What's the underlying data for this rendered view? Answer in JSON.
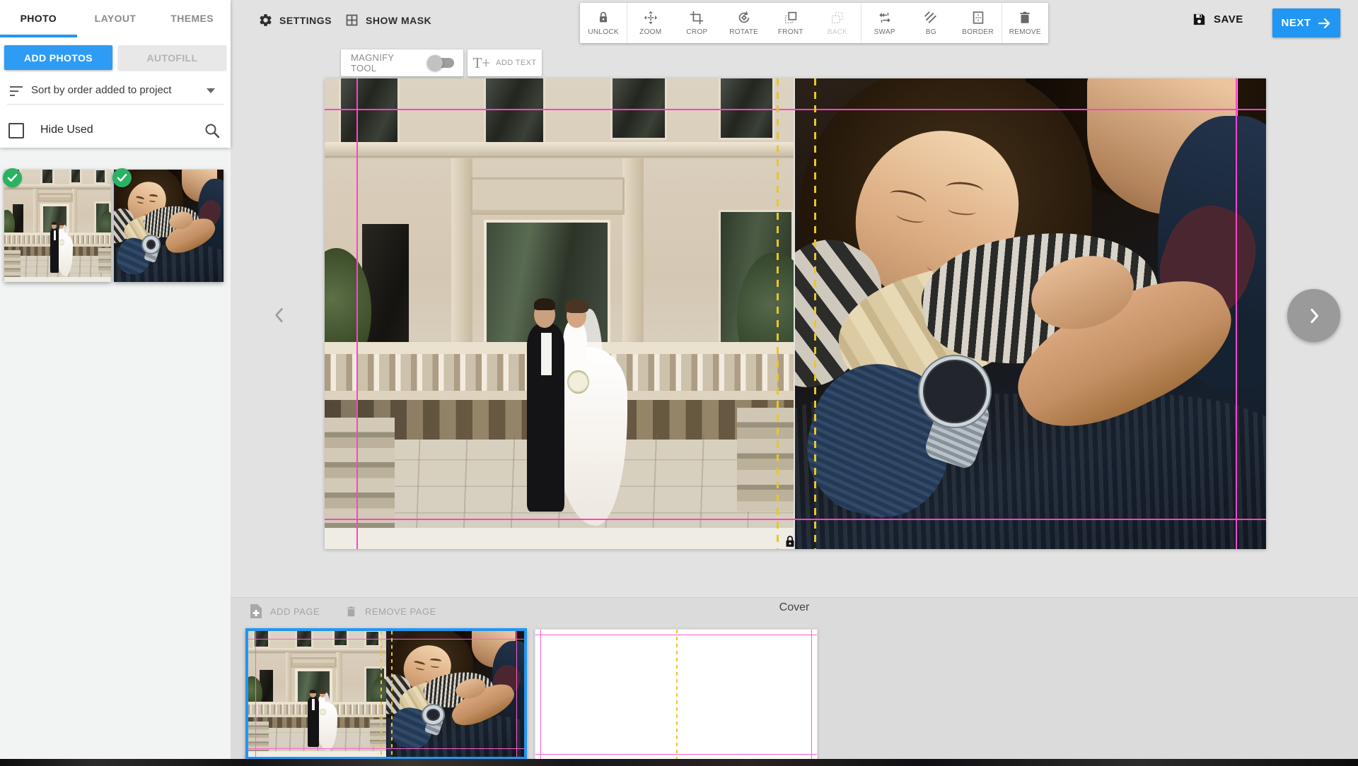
{
  "colors": {
    "accent": "#2196f3",
    "guide_pink": "#ff42cd",
    "guide_yellow": "#e7c62e",
    "check_green": "#2bb162"
  },
  "sidebar": {
    "tabs": [
      {
        "label": "PHOTO"
      },
      {
        "label": "LAYOUT"
      },
      {
        "label": "THEMES"
      }
    ],
    "active_tab": "PHOTO",
    "add_photos_label": "ADD PHOTOS",
    "autofill_label": "AUTOFILL",
    "sort_label": "Sort by order added to project",
    "hide_used_label": "Hide Used",
    "photos": [
      {
        "name": "wedding couple in front of mansion",
        "used": true
      },
      {
        "name": "couple hugging close-up",
        "used": true
      }
    ]
  },
  "topbar": {
    "settings_label": "SETTINGS",
    "show_mask_label": "SHOW MASK",
    "save_label": "SAVE",
    "next_label": "NEXT"
  },
  "edit_toolbar": {
    "buttons": [
      {
        "label": "UNLOCK",
        "icon": "lock",
        "disabled": false
      },
      {
        "label": "ZOOM",
        "icon": "move-arrows",
        "disabled": false
      },
      {
        "label": "CROP",
        "icon": "crop",
        "disabled": false
      },
      {
        "label": "ROTATE",
        "icon": "rotate",
        "disabled": false
      },
      {
        "label": "FRONT",
        "icon": "bring-front",
        "disabled": false
      },
      {
        "label": "BACK",
        "icon": "send-back",
        "disabled": true
      },
      {
        "label": "SWAP",
        "icon": "swap-arrows",
        "disabled": false
      },
      {
        "label": "BG",
        "icon": "background-hatch",
        "disabled": false
      },
      {
        "label": "BORDER",
        "icon": "border-frame",
        "disabled": false
      },
      {
        "label": "REMOVE",
        "icon": "trash",
        "disabled": false
      }
    ]
  },
  "canvas_tools": {
    "magnify_label": "MAGNIFY TOOL",
    "magnify_on": false,
    "add_text_label": "ADD TEXT",
    "add_text_icon": "T+"
  },
  "pages_bar": {
    "add_page_label": "ADD PAGE",
    "remove_page_label": "REMOVE PAGE",
    "current_page_label": "Cover",
    "spreads": [
      {
        "name": "cover spread with two photos",
        "selected": true
      },
      {
        "name": "blank inside spread",
        "selected": false
      }
    ]
  }
}
